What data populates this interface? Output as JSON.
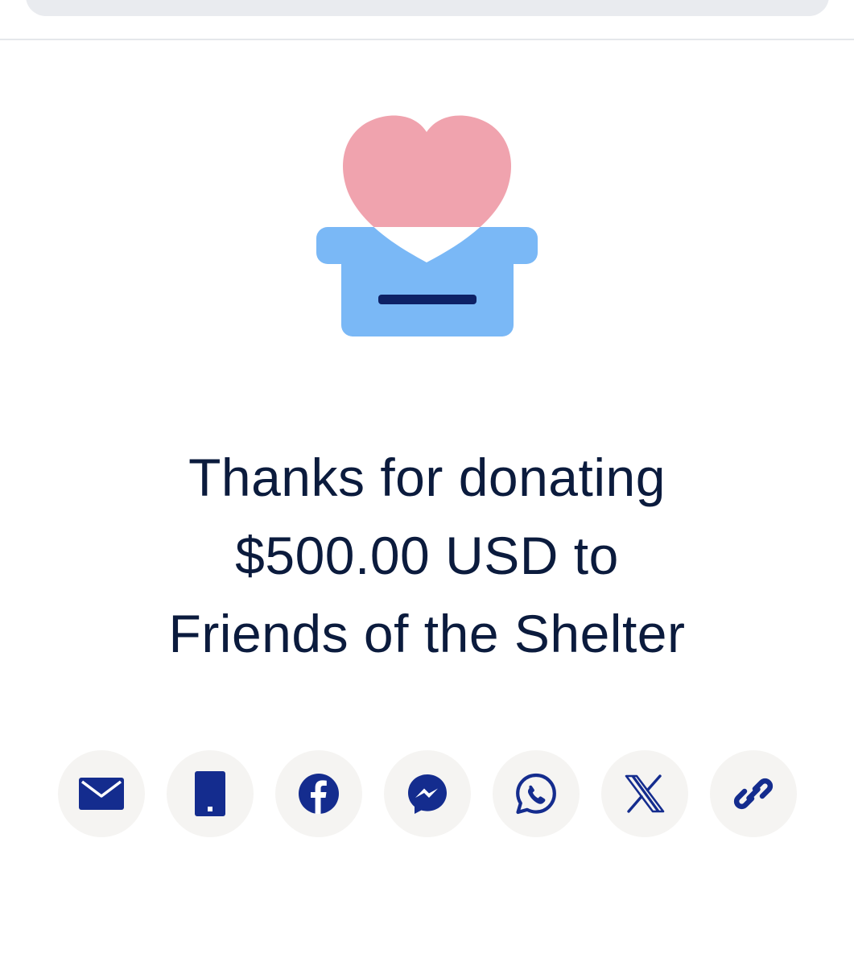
{
  "colors": {
    "brand_navy": "#142c8e",
    "text_dark": "#0b1b3d",
    "heart_pink": "#f0a3ae",
    "box_blue": "#7ab8f6",
    "button_bg": "#f5f4f2"
  },
  "illustration": {
    "icon": "heart-in-donation-box-icon"
  },
  "message": {
    "line1": "Thanks for donating",
    "line2": "$500.00 USD to",
    "line3": "Friends of the Shelter"
  },
  "share": {
    "buttons": [
      {
        "icon": "email-icon"
      },
      {
        "icon": "phone-sms-icon"
      },
      {
        "icon": "facebook-icon"
      },
      {
        "icon": "messenger-icon"
      },
      {
        "icon": "whatsapp-icon"
      },
      {
        "icon": "x-icon"
      },
      {
        "icon": "link-icon"
      }
    ]
  }
}
